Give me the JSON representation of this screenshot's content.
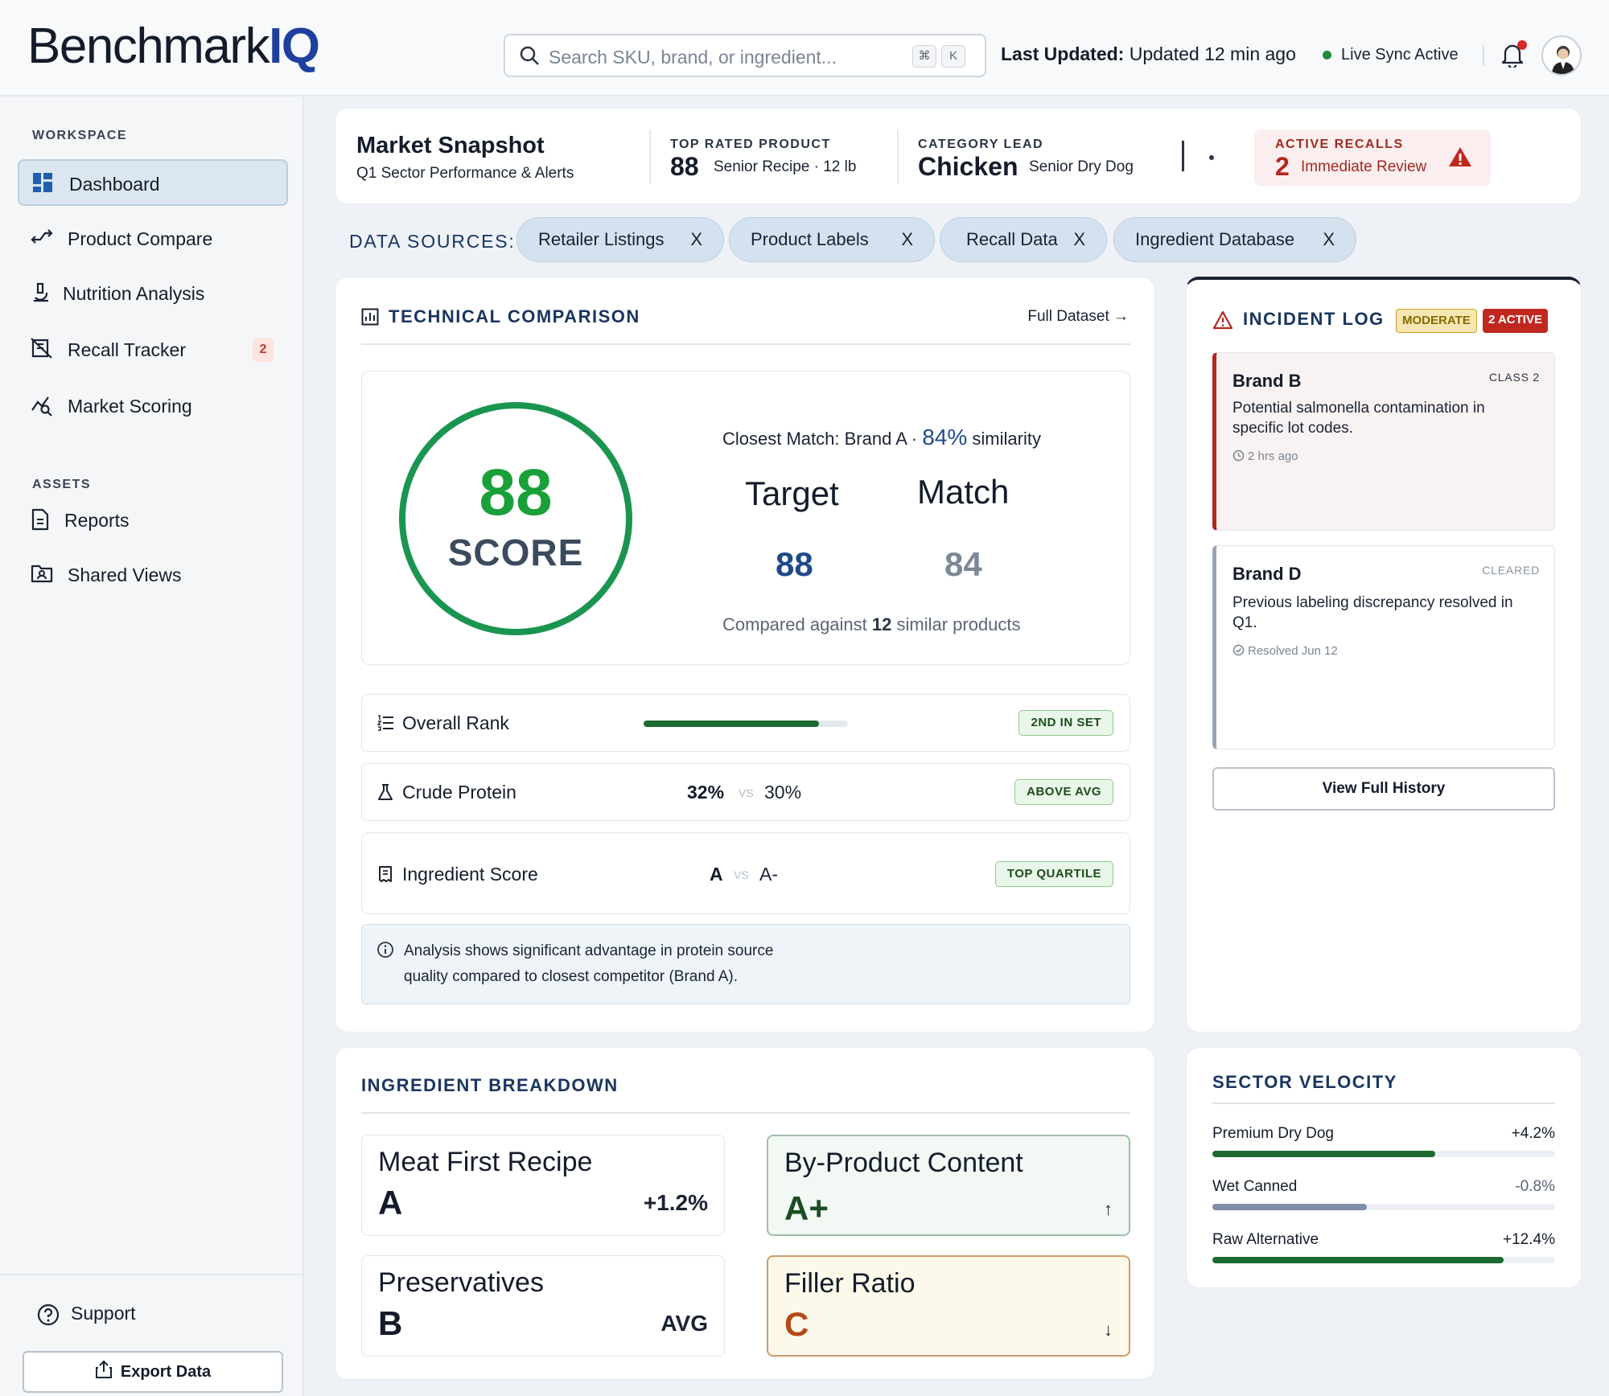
{
  "header": {
    "logo_main": "Benchmark",
    "logo_accent": "IQ",
    "search_placeholder": "Search SKU, brand, or ingredient...",
    "kbd_cmd": "⌘",
    "kbd_k": "K",
    "last_updated_label": "Last Updated:",
    "last_updated_value": "Updated 12 min ago",
    "sync_status": "Live Sync Active"
  },
  "sidebar": {
    "workspace_label": "WORKSPACE",
    "items": [
      {
        "label": "Dashboard",
        "icon": "grid-icon",
        "active": true
      },
      {
        "label": "Product Compare",
        "icon": "compare-arrows-icon"
      },
      {
        "label": "Nutrition Analysis",
        "icon": "microscope-icon"
      },
      {
        "label": "Recall Tracker",
        "icon": "recall-icon",
        "badge": "2"
      },
      {
        "label": "Market Scoring",
        "icon": "trend-search-icon"
      }
    ],
    "assets_label": "ASSETS",
    "assets": [
      {
        "label": "Reports",
        "icon": "document-icon"
      },
      {
        "label": "Shared Views",
        "icon": "shared-folder-icon"
      }
    ],
    "support_label": "Support",
    "export_label": "Export Data"
  },
  "snapshot": {
    "title": "Market Snapshot",
    "subtitle": "Q1 Sector Performance & Alerts",
    "top_rated_label": "TOP RATED PRODUCT",
    "top_rated_value": "88",
    "top_rated_detail": "Senior Recipe · 12 lb",
    "category_lead_label": "CATEGORY LEAD",
    "category_lead_value": "Chicken",
    "category_lead_detail": "Senior Dry Dog",
    "recalls_label": "ACTIVE RECALLS",
    "recalls_value": "2",
    "recalls_detail": "Immediate Review"
  },
  "data_sources": {
    "label": "DATA SOURCES:",
    "items": [
      "Retailer Listings",
      "Product Labels",
      "Recall Data",
      "Ingredient Database"
    ],
    "remove_glyph": "X"
  },
  "technical": {
    "title": "TECHNICAL COMPARISON",
    "full_dataset": "Full Dataset →",
    "score": "88",
    "score_label": "SCORE",
    "closest_prefix": "Closest Match: Brand A · ",
    "closest_pct": "84%",
    "closest_suffix": " similarity",
    "target_label": "Target",
    "match_label": "Match",
    "target_value": "88",
    "match_value": "84",
    "compared_prefix": "Compared against ",
    "compared_count": "12",
    "compared_suffix": " similar products",
    "rank_label": "Overall Rank",
    "rank_progress": 0.86,
    "rank_tag": "2ND IN SET",
    "protein_label": "Crude Protein",
    "protein_a": "32%",
    "vs": "VS",
    "protein_b": "30%",
    "protein_tag": "ABOVE AVG",
    "ingredient_label": "Ingredient Score",
    "ingredient_a": "A",
    "ingredient_b": "A-",
    "ingredient_tag": "TOP QUARTILE",
    "note_line1": "Analysis shows significant advantage in protein source",
    "note_line2": "quality compared to closest competitor (Brand A)."
  },
  "incident": {
    "title": "INCIDENT LOG",
    "moderate_tag": "MODERATE",
    "active_tag": "2 ACTIVE",
    "items": [
      {
        "brand": "Brand B",
        "status": "CLASS  2",
        "desc": "Potential salmonella contamination in specific lot codes.",
        "time": "2 hrs ago"
      },
      {
        "brand": "Brand D",
        "status": "CLEARED",
        "desc": "Previous labeling discrepancy resolved in Q1.",
        "time": "Resolved Jun 12"
      }
    ],
    "view_history": "View Full History"
  },
  "ingredient_breakdown": {
    "title": "INGREDIENT BREAKDOWN",
    "cards": [
      {
        "title": "Meat First Recipe",
        "grade": "A",
        "right": "+1.2%"
      },
      {
        "title": "By-Product Content",
        "grade": "A+",
        "right": "↑"
      },
      {
        "title": "Preservatives",
        "grade": "B",
        "right": "AVG"
      },
      {
        "title": "Filler Ratio",
        "grade": "C",
        "right": "↓"
      }
    ]
  },
  "velocity": {
    "title": "SECTOR VELOCITY",
    "rows": [
      {
        "name": "Premium Dry Dog",
        "value": "+4.2%",
        "fill": 0.65,
        "color": "#1e6b32"
      },
      {
        "name": "Wet Canned",
        "value": "-0.8%",
        "fill": 0.45,
        "color": "#7d8fa6"
      },
      {
        "name": "Raw Alternative",
        "value": "+12.4%",
        "fill": 0.85,
        "color": "#1e6b32"
      }
    ]
  },
  "colors": {
    "brand_blue": "#1f3f9e",
    "navy": "#1a3560",
    "score_green": "#1aa03a",
    "alert_red": "#c0392b",
    "moderate_yellow": "#c9a227"
  }
}
